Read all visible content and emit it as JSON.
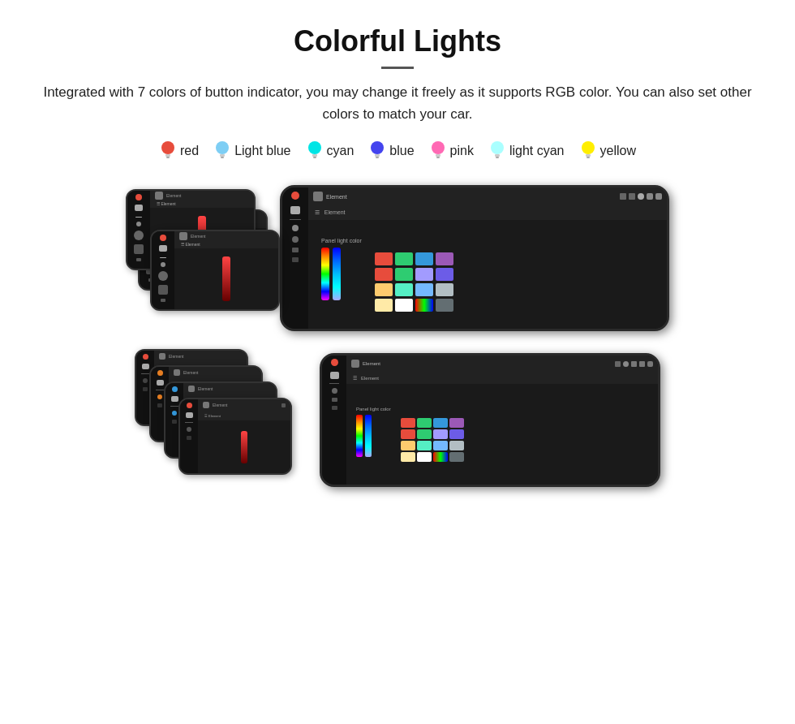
{
  "header": {
    "title": "Colorful Lights",
    "description": "Integrated with 7 colors of button indicator, you may change it freely as it supports RGB color. You can also set other colors to match your car."
  },
  "colors": [
    {
      "name": "red",
      "color": "#e74c3c",
      "bulb_color": "#e74c3c"
    },
    {
      "name": "Light blue",
      "color": "#7ecef4",
      "bulb_color": "#7ecef4"
    },
    {
      "name": "cyan",
      "color": "#00e5e5",
      "bulb_color": "#00e5e5"
    },
    {
      "name": "blue",
      "color": "#4444ee",
      "bulb_color": "#4444ee"
    },
    {
      "name": "pink",
      "color": "#ff69b4",
      "bulb_color": "#ff69b4"
    },
    {
      "name": "light cyan",
      "color": "#aaffff",
      "bulb_color": "#aaffff"
    },
    {
      "name": "yellow",
      "color": "#ffee00",
      "bulb_color": "#ffee00"
    }
  ],
  "panel_label": "Panel light color",
  "topbar_text": "Element"
}
